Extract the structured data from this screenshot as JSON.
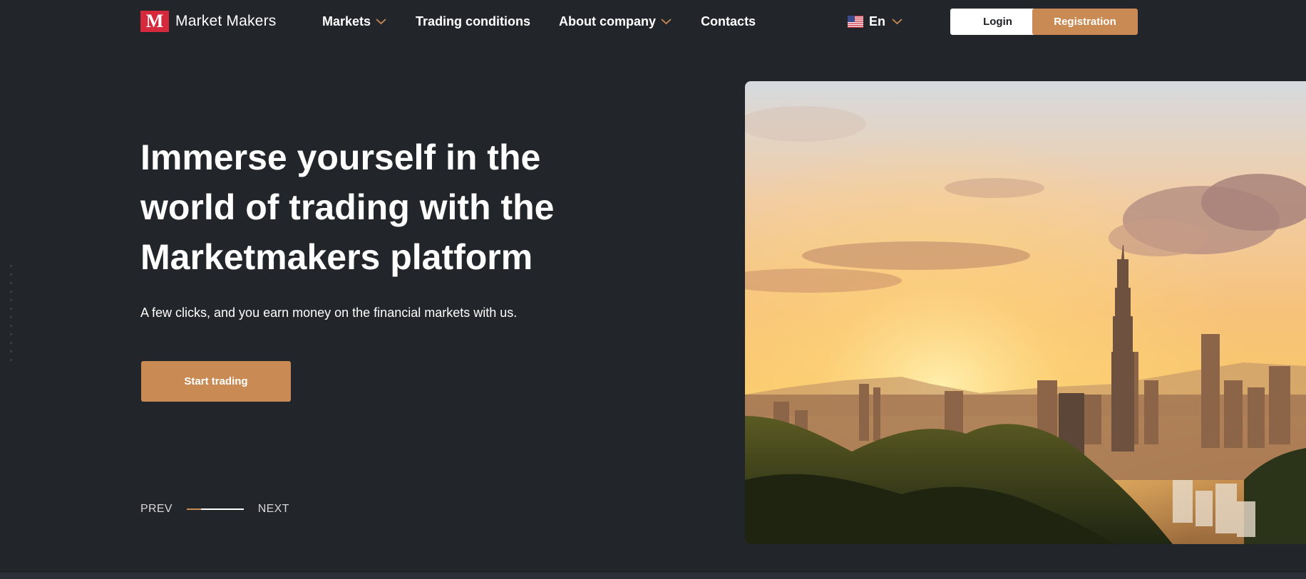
{
  "brand": {
    "logo_letter": "M",
    "name": "Market Makers",
    "logo_color": "#d42a3c"
  },
  "nav": {
    "items": [
      {
        "label": "Markets",
        "has_dropdown": true
      },
      {
        "label": "Trading conditions",
        "has_dropdown": false
      },
      {
        "label": "About company",
        "has_dropdown": true
      },
      {
        "label": "Contacts",
        "has_dropdown": false
      }
    ],
    "chevron_icon": "chevron-down-icon",
    "chevron_color": "#c98b53"
  },
  "language": {
    "code": "En",
    "flag_icon": "us-flag-icon"
  },
  "auth": {
    "login_label": "Login",
    "registration_label": "Registration"
  },
  "hero": {
    "title_lines": [
      "Immerse yourself in the",
      "world of trading with the",
      "Marketmakers platform"
    ],
    "subtitle": "A few clicks, and you earn money on the financial markets with us.",
    "cta_label": "Start trading",
    "image_icon": "city-skyline-sunset-image"
  },
  "slider": {
    "prev_label": "PREV",
    "next_label": "NEXT",
    "progress_fraction": 0.25
  },
  "colors": {
    "background": "#22252a",
    "accent": "#c98b53",
    "text": "#ffffff"
  }
}
